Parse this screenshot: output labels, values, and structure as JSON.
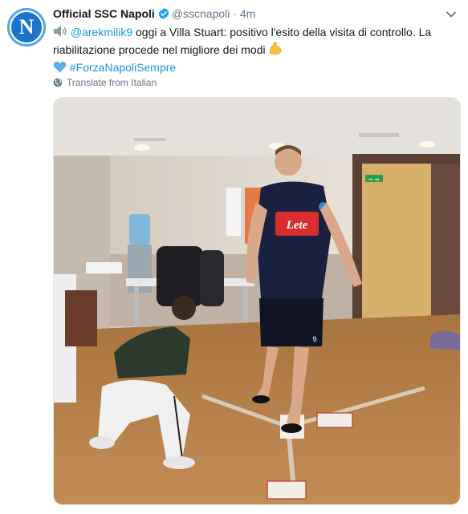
{
  "tweet": {
    "display_name": "Official SSC Napoli",
    "handle": "@sscnapoli",
    "separator": "·",
    "time": "4m",
    "avatar_letter": "N",
    "mention": "@arekmilik9",
    "text_part1": " oggi a Villa Stuart: positivo l'esito della visita di controllo. La riabilitazione procede nel migliore dei modi ",
    "hashtag": "#ForzaNapoliSempre",
    "translate_label": "Translate from Italian"
  },
  "photo": {
    "shirt_sponsor": "Lete",
    "exit_sign": "→ ⇥",
    "shirt_number": "9"
  },
  "icons": {
    "speaker": "speaker-icon",
    "bicep": "flexed-biceps-icon",
    "heart": "blue-heart-icon",
    "verified": "verified-badge-icon",
    "globe": "globe-icon",
    "caret": "chevron-down-icon"
  },
  "colors": {
    "link": "#1b95e0",
    "verified": "#1da1f2",
    "napoli_blue": "#1c74c9"
  }
}
